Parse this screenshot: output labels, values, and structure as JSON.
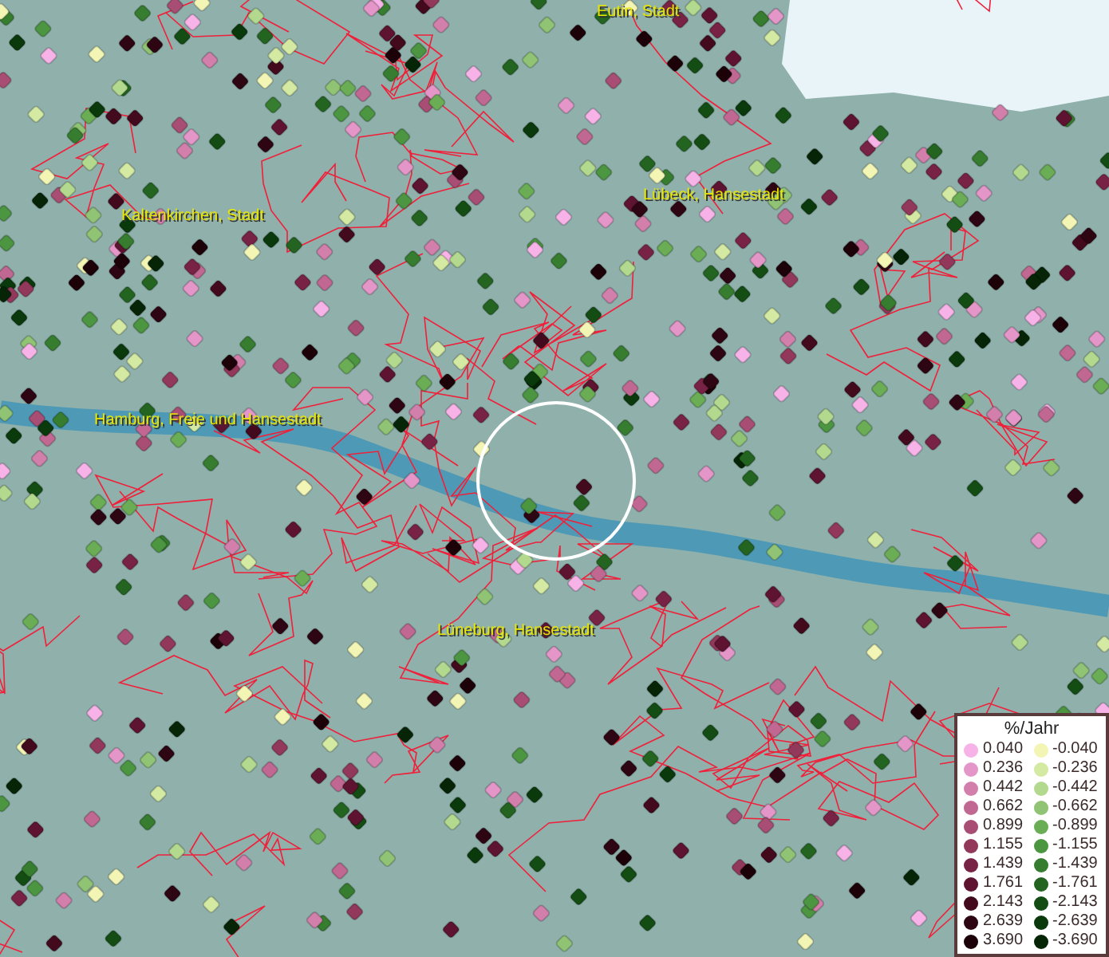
{
  "map": {
    "places": [
      {
        "name": "Eutin, Stadt"
      },
      {
        "name": "Kaltenkirchen, Stadt"
      },
      {
        "name": "Lübeck, Hansestadt"
      },
      {
        "name": "Hamburg, Freie und Hansestadt"
      },
      {
        "name": "Lüneburg, Hansestadt"
      }
    ]
  },
  "legend": {
    "title": "%/Jahr",
    "items": [
      {
        "value": "0.040",
        "color": "#f7b2e8"
      },
      {
        "value": "-0.040",
        "color": "#f2f5b4"
      },
      {
        "value": "0.236",
        "color": "#e496c8"
      },
      {
        "value": "-0.236",
        "color": "#d4e9a2"
      },
      {
        "value": "0.442",
        "color": "#d37fac"
      },
      {
        "value": "-0.442",
        "color": "#b3d98f"
      },
      {
        "value": "0.662",
        "color": "#c16892"
      },
      {
        "value": "-0.662",
        "color": "#90c474"
      },
      {
        "value": "0.899",
        "color": "#a84d74"
      },
      {
        "value": "-0.899",
        "color": "#6aad55"
      },
      {
        "value": "1.155",
        "color": "#92385a"
      },
      {
        "value": "-1.155",
        "color": "#4c9541"
      },
      {
        "value": "1.439",
        "color": "#782345"
      },
      {
        "value": "-1.439",
        "color": "#367d2f"
      },
      {
        "value": "1.761",
        "color": "#5e1430"
      },
      {
        "value": "-1.761",
        "color": "#236520"
      },
      {
        "value": "2.143",
        "color": "#430a1e"
      },
      {
        "value": "-2.143",
        "color": "#134d13"
      },
      {
        "value": "2.639",
        "color": "#2e0512"
      },
      {
        "value": "-2.639",
        "color": "#0a390b"
      },
      {
        "value": "3.690",
        "color": "#1c0208"
      },
      {
        "value": "-3.690",
        "color": "#052506"
      }
    ]
  }
}
